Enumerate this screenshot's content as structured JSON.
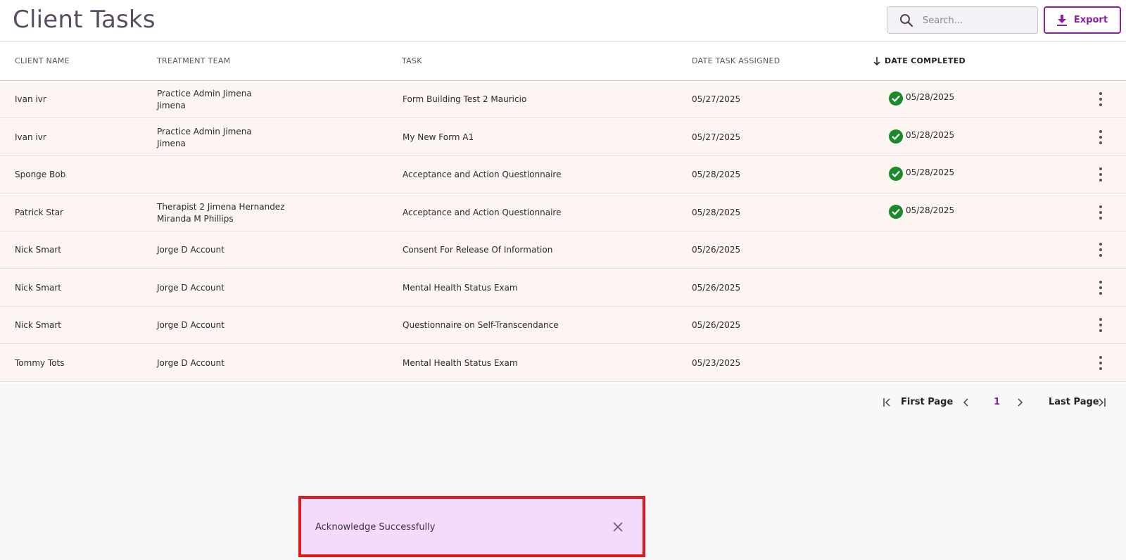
{
  "header": {
    "title": "Client Tasks",
    "search_placeholder": "Search...",
    "export_label": "Export"
  },
  "table": {
    "columns": {
      "client_name": "CLIENT NAME",
      "treatment_team": "TREATMENT TEAM",
      "task": "TASK",
      "date_assigned": "DATE TASK ASSIGNED",
      "date_completed": "DATE COMPLETED"
    },
    "sort": {
      "column": "date_completed",
      "direction": "descending"
    },
    "rows": [
      {
        "client": "Ivan ivr",
        "team1": "Practice Admin Jimena",
        "team2": "Jimena",
        "task": "Form Building Test 2 Mauricio",
        "assigned": "05/27/2025",
        "completed": "05/28/2025"
      },
      {
        "client": "Ivan ivr",
        "team1": "Practice Admin Jimena",
        "team2": "Jimena",
        "task": "My New Form A1",
        "assigned": "05/27/2025",
        "completed": "05/28/2025"
      },
      {
        "client": "Sponge Bob",
        "team1": "",
        "team2": "",
        "task": "Acceptance and Action Questionnaire",
        "assigned": "05/28/2025",
        "completed": "05/28/2025"
      },
      {
        "client": "Patrick Star",
        "team1": "Therapist 2 Jimena Hernandez",
        "team2": "Miranda M Phillips",
        "task": "Acceptance and Action Questionnaire",
        "assigned": "05/28/2025",
        "completed": "05/28/2025"
      },
      {
        "client": "Nick Smart",
        "team1": "Jorge D Account",
        "team2": "",
        "task": "Consent For Release Of Information",
        "assigned": "05/26/2025",
        "completed": ""
      },
      {
        "client": "Nick Smart",
        "team1": "Jorge D Account",
        "team2": "",
        "task": "Mental Health Status Exam",
        "assigned": "05/26/2025",
        "completed": ""
      },
      {
        "client": "Nick Smart",
        "team1": "Jorge D Account",
        "team2": "",
        "task": "Questionnaire on Self-Transcendance",
        "assigned": "05/26/2025",
        "completed": ""
      },
      {
        "client": "Tommy Tots",
        "team1": "Jorge D Account",
        "team2": "",
        "task": "Mental Health Status Exam",
        "assigned": "05/23/2025",
        "completed": ""
      }
    ]
  },
  "pagination": {
    "first_label": "First Page",
    "current_page": "1",
    "last_label": "Last Page"
  },
  "toast": {
    "message": "Acknowledge Successfully"
  },
  "colors": {
    "accent": "#8a1fa8",
    "row_bg": "#fdf5f1",
    "check_green": "#1a8a2a",
    "toast_bg": "#f4dbfb",
    "toast_border": "#e01818"
  },
  "icons": {
    "search": "search-icon",
    "export": "download-icon",
    "completed": "check-circle-icon",
    "row_menu": "kebab-menu-icon",
    "close": "close-icon"
  }
}
